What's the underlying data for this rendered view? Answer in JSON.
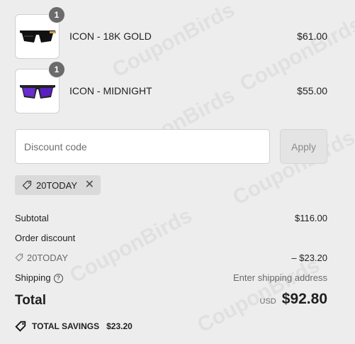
{
  "items": [
    {
      "quantity": "1",
      "name": "ICON - 18K GOLD",
      "price": "$61.00"
    },
    {
      "quantity": "1",
      "name": "ICON - MIDNIGHT",
      "price": "$55.00"
    }
  ],
  "discount": {
    "placeholder": "Discount code",
    "apply_label": "Apply",
    "applied_code": "20TODAY"
  },
  "summary": {
    "subtotal_label": "Subtotal",
    "subtotal_value": "$116.00",
    "order_discount_label": "Order discount",
    "discount_code": "20TODAY",
    "discount_value": "– $23.20",
    "shipping_label": "Shipping",
    "shipping_value": "Enter shipping address",
    "total_label": "Total",
    "currency": "USD",
    "total_value": "$92.80",
    "savings_label": "TOTAL SAVINGS",
    "savings_value": "$23.20"
  },
  "watermark": "CouponBirds"
}
